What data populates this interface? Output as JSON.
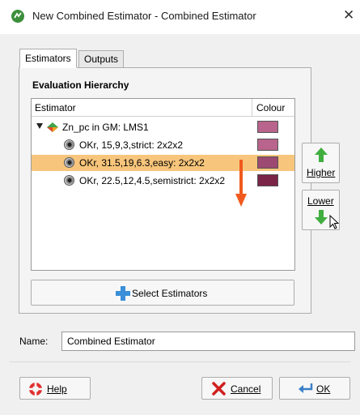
{
  "window": {
    "title": "New Combined Estimator - Combined Estimator",
    "close_glyph": "✕"
  },
  "tabs": [
    {
      "label": "Estimators",
      "active": true
    },
    {
      "label": "Outputs",
      "active": false
    }
  ],
  "hierarchy": {
    "group_title": "Evaluation Hierarchy",
    "columns": {
      "estimator": "Estimator",
      "colour": "Colour"
    },
    "rows": [
      {
        "label": "Zn_pc in GM: LMS1",
        "level": 0,
        "icon": "geological-model-icon",
        "colour": "#b8648c",
        "selected": false,
        "expanded": true
      },
      {
        "label": "OKr, 15,9,3,strict: 2x2x2",
        "level": 1,
        "icon": "estimator-icon",
        "colour": "#b8648c",
        "selected": false
      },
      {
        "label": "OKr, 31.5,19,6.3,easy: 2x2x2",
        "level": 1,
        "icon": "estimator-icon",
        "colour": "#9c4a72",
        "selected": true
      },
      {
        "label": "OKr, 22.5,12,4.5,semistrict: 2x2x2",
        "level": 1,
        "icon": "estimator-icon",
        "colour": "#7a2448",
        "selected": false
      }
    ]
  },
  "buttons": {
    "higher_label": "Higher",
    "lower_label": "Lower",
    "select_estimators_label": "Select Estimators",
    "help_label": "Help",
    "cancel_label": "Cancel",
    "ok_label": "OK"
  },
  "name_field": {
    "label": "Name:",
    "value": "Combined Estimator"
  },
  "colors": {
    "selection": "#f7c57b",
    "arrow_green": "#3fae3f",
    "arrow_red": "#f05a1e",
    "plus_blue": "#3a8fd8"
  }
}
